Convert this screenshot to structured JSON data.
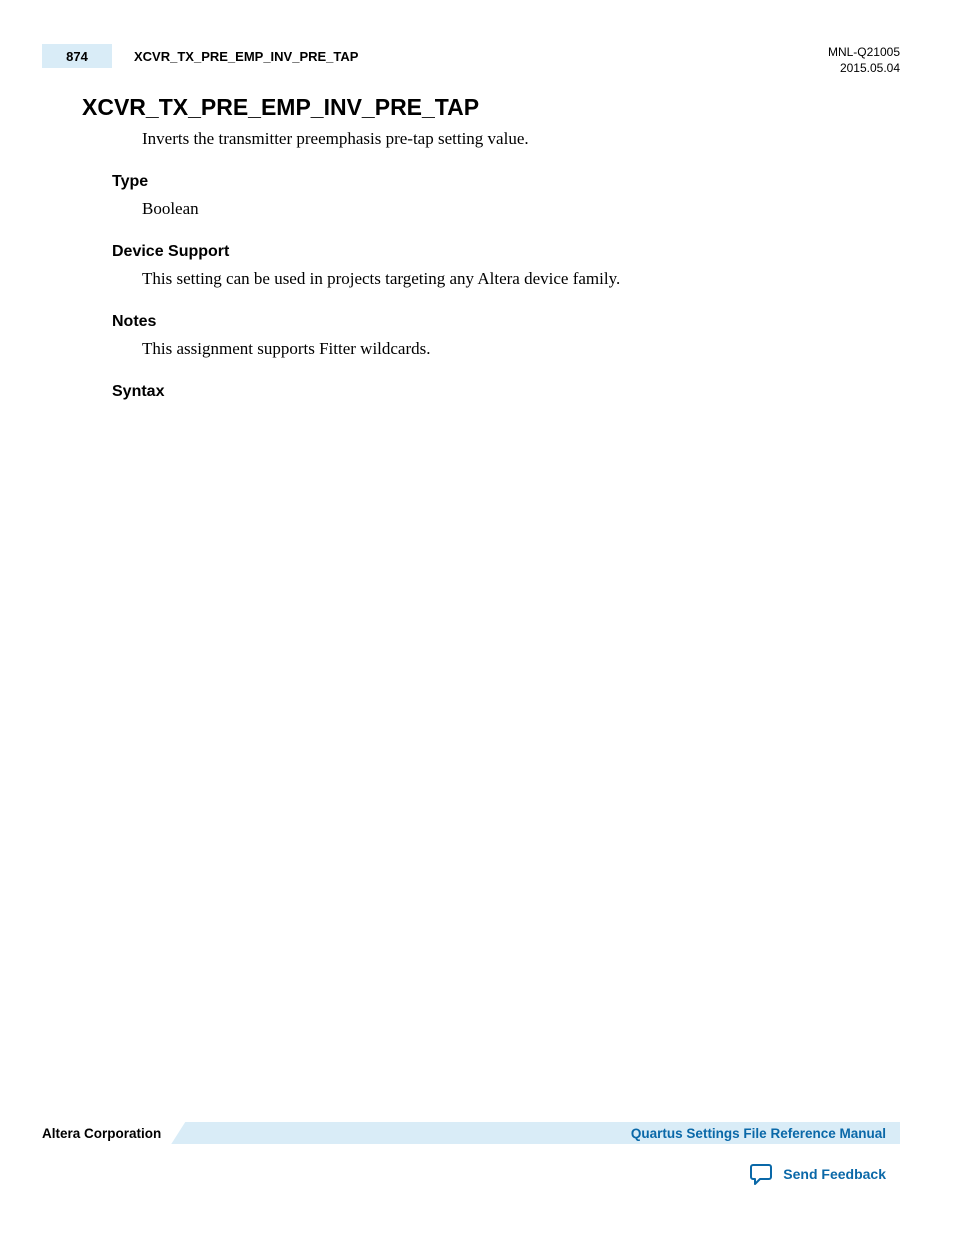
{
  "header": {
    "page_number": "874",
    "running_title": "XCVR_TX_PRE_EMP_INV_PRE_TAP",
    "doc_id": "MNL-Q21005",
    "doc_date": "2015.05.04"
  },
  "title": "XCVR_TX_PRE_EMP_INV_PRE_TAP",
  "description": "Inverts the transmitter preemphasis pre-tap setting value.",
  "sections": {
    "type": {
      "heading": "Type",
      "body": "Boolean"
    },
    "device_support": {
      "heading": "Device Support",
      "body": "This setting can be used in projects targeting any Altera device family."
    },
    "notes": {
      "heading": "Notes",
      "body": "This assignment supports Fitter wildcards."
    },
    "syntax": {
      "heading": "Syntax",
      "body": ""
    }
  },
  "footer": {
    "company": "Altera Corporation",
    "manual_link": "Quartus Settings File Reference Manual",
    "feedback_link": "Send Feedback"
  }
}
